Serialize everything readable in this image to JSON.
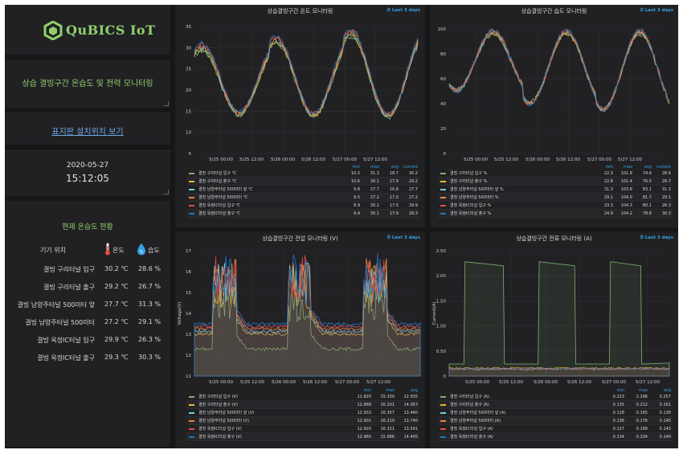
{
  "logo_text": "QuBICS IoT",
  "dashboard_title": "상습 결빙구간 온습도 및 전력 모니터링",
  "link_text": "표지판 설치위치 보기",
  "date": "2020-05-27",
  "time": "15:12:05",
  "status": {
    "title": "현재 온습도 현황",
    "col_location": "기기 위치",
    "col_temp": "온도",
    "col_humidity": "습도",
    "rows": [
      {
        "name": "결빙 구리터널 입구",
        "temp": "30.2 ℃",
        "hum": "28.6 %"
      },
      {
        "name": "결빙 구리터널 출구",
        "temp": "29.2 ℃",
        "hum": "26.7 %"
      },
      {
        "name": "결빙 남양주터널 500미터 앞",
        "temp": "27.7 ℃",
        "hum": "31.3 %"
      },
      {
        "name": "결빙 남양주터널 500미터",
        "temp": "27.2 ℃",
        "hum": "29.1 %"
      },
      {
        "name": "결빙 옥정IC터널 입구",
        "temp": "29.9 ℃",
        "hum": "26.3 %"
      },
      {
        "name": "결빙 옥정IC터널 출구",
        "temp": "29.3 ℃",
        "hum": "30.3 %"
      }
    ]
  },
  "colors": {
    "series": [
      "#7eb26d",
      "#eab839",
      "#6ed0e0",
      "#ef843c",
      "#e24d42",
      "#1f78c1"
    ],
    "accent": "#33a2e5",
    "title_green": "#8fd16a",
    "panel_bg": "#212124",
    "page_bg": "#161719"
  },
  "legend_headers": {
    "min": "min",
    "max": "max",
    "avg": "avg",
    "current": "current"
  },
  "chart_data": [
    {
      "type": "line",
      "title": "상습결빙구간 온도 모니터링",
      "time_range": "Last 3 days",
      "x_ticks": [
        "5/25 00:00",
        "5/25 12:00",
        "5/26 00:00",
        "5/26 12:00",
        "5/27 00:00",
        "5/27 12:00"
      ],
      "ylim": [
        5,
        35
      ],
      "y_ticks": [
        "5",
        "10",
        "15",
        "20",
        "25",
        "30",
        "35"
      ],
      "ylabel": "",
      "series": [
        {
          "name": "결빙 구리터널 입구 ℃",
          "min": "10.3",
          "max": "31.3",
          "avg": "18.7",
          "current": "30.2"
        },
        {
          "name": "결빙 구리터널 출구 ℃",
          "min": "10.6",
          "max": "30.1",
          "avg": "17.9",
          "current": "29.2"
        },
        {
          "name": "결빙 남양주터널 500미터 앞 ℃",
          "min": "9.8",
          "max": "27.7",
          "avg": "16.8",
          "current": "27.7"
        },
        {
          "name": "결빙 남양주터널 500미터 ℃",
          "min": "9.5",
          "max": "27.2",
          "avg": "17.0",
          "current": "27.2"
        },
        {
          "name": "결빙 옥정IC터널 입구 ℃",
          "min": "8.9",
          "max": "30.2",
          "avg": "17.5",
          "current": "29.9"
        },
        {
          "name": "결빙 옥정IC터널 출구 ℃",
          "min": "9.4",
          "max": "30.1",
          "avg": "17.9",
          "current": "29.3"
        }
      ]
    },
    {
      "type": "line",
      "title": "상습결빙구간 습도 모니터링",
      "time_range": "Last 3 days",
      "x_ticks": [
        "5/25 00:00",
        "5/25 12:00",
        "5/26 00:00",
        "5/26 12:00",
        "5/27 00:00",
        "5/27 12:00"
      ],
      "ylim": [
        0,
        100
      ],
      "y_ticks": [
        "0",
        "20",
        "40",
        "60",
        "80",
        "100"
      ],
      "ylabel": "",
      "series": [
        {
          "name": "결빙 구리터널 입구 %",
          "min": "22.3",
          "max": "101.8",
          "avg": "74.6",
          "current": "28.6"
        },
        {
          "name": "결빙 구리터널 출구 %",
          "min": "22.8",
          "max": "101.4",
          "avg": "76.5",
          "current": "26.7"
        },
        {
          "name": "결빙 남양주터널 500미터 앞 %",
          "min": "31.3",
          "max": "103.8",
          "avg": "83.1",
          "current": "31.3"
        },
        {
          "name": "결빙 남양주터널 500미터 %",
          "min": "29.1",
          "max": "104.0",
          "avg": "81.7",
          "current": "29.1"
        },
        {
          "name": "결빙 옥정IC터널 입구 %",
          "min": "23.3",
          "max": "104.3",
          "avg": "80.1",
          "current": "26.3"
        },
        {
          "name": "결빙 옥정IC터널 출구 %",
          "min": "24.9",
          "max": "104.2",
          "avg": "78.8",
          "current": "30.3"
        }
      ]
    },
    {
      "type": "area",
      "title": "상습결빙구간 전압 모니터링 (V)",
      "time_range": "Last 3 days",
      "x_ticks": [
        "5/25 00:00",
        "5/25 12:00",
        "5/26 00:00",
        "5/26 12:00",
        "5/27 00:00",
        "5/27 12:00"
      ],
      "ylim": [
        11,
        17
      ],
      "y_ticks": [
        "11",
        "12",
        "13",
        "14",
        "15",
        "16",
        "17"
      ],
      "ylabel": "Voltage(V)",
      "series": [
        {
          "name": "결빙 구리터널 입구 (V)",
          "min": "11.820",
          "max": "15.330",
          "avg": "12.935"
        },
        {
          "name": "결빙 구리터널 출구 (V)",
          "min": "12.868",
          "max": "16.201",
          "avg": "14.067"
        },
        {
          "name": "결빙 남양주터널 500미터 앞 (V)",
          "min": "12.933",
          "max": "16.357",
          "avg": "13.460"
        },
        {
          "name": "결빙 남양주터널 500미터 (V)",
          "min": "12.901",
          "max": "16.210",
          "avg": "13.740"
        },
        {
          "name": "결빙 옥정IC터널 입구 (V)",
          "min": "12.920",
          "max": "16.321",
          "avg": "13.591"
        },
        {
          "name": "결빙 옥정IC터널 출구 (V)",
          "min": "12.960",
          "max": "15.986",
          "avg": "14.405"
        }
      ]
    },
    {
      "type": "area",
      "title": "상습결빙구간 전류 모니터링 (A)",
      "time_range": "Last 3 days",
      "x_ticks": [
        "5/25 00:00",
        "5/25 12:00",
        "5/26 00:00",
        "5/26 12:00",
        "5/27 00:00",
        "5/27 12:00"
      ],
      "ylim": [
        0,
        2.5
      ],
      "y_ticks": [
        "0",
        "0.50",
        "1.00",
        "1.50",
        "2.00",
        "2.50"
      ],
      "ylabel": "Current(A)",
      "series": [
        {
          "name": "결빙 구리터널 입구 (A)",
          "min": "0.223",
          "max": "2.296",
          "avg": "0.257"
        },
        {
          "name": "결빙 구리터널 출구 (A)",
          "min": "0.135",
          "max": "0.212",
          "avg": "0.161"
        },
        {
          "name": "결빙 남양주터널 500미터 앞 (A)",
          "min": "0.128",
          "max": "0.165",
          "avg": "0.138"
        },
        {
          "name": "결빙 남양주터널 500미터 (A)",
          "min": "0.136",
          "max": "0.176",
          "avg": "0.145"
        },
        {
          "name": "결빙 옥정IC터널 입구 (A)",
          "min": "0.127",
          "max": "0.168",
          "avg": "0.143"
        },
        {
          "name": "결빙 옥정IC터널 출구 (A)",
          "min": "0.134",
          "max": "0.204",
          "avg": "0.149"
        }
      ]
    }
  ]
}
